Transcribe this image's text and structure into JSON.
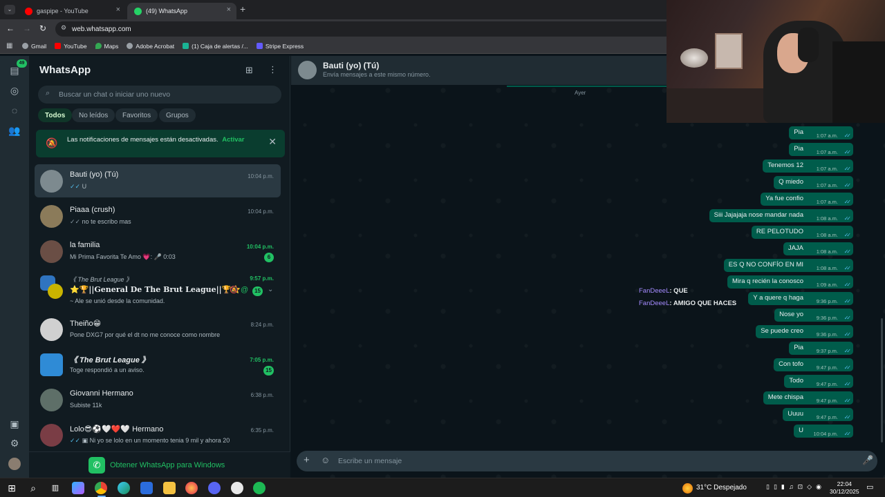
{
  "browser": {
    "tabs": [
      {
        "title": "gaspipe - YouTube"
      },
      {
        "title": "(49) WhatsApp"
      }
    ],
    "url": "web.whatsapp.com",
    "bookmarks": [
      "Gmail",
      "YouTube",
      "Maps",
      "Adobe Acrobat",
      "(1) Caja de alertas /...",
      "Stripe Express"
    ]
  },
  "rail": {
    "unread_badge": "49"
  },
  "sidebar": {
    "title": "WhatsApp",
    "search_placeholder": "Buscar un chat o iniciar uno nuevo",
    "filters": [
      "Todos",
      "No leídos",
      "Favoritos",
      "Grupos"
    ],
    "notification": {
      "text": "Las notificaciones de mensajes están desactivadas.",
      "action": "Activar"
    },
    "chats": [
      {
        "name": "Bauti (yo) (Tú)",
        "last": "U",
        "time": "10:04 p.m.",
        "checks": true
      },
      {
        "name": "Piaaa (crush)",
        "last": "no te escribo mas",
        "time": "10:04 p.m.",
        "checks": true
      },
      {
        "name": "la familia",
        "last": "Mi Prima Favorita Te Amo 💗: 🎤 0:03",
        "time": "10:04 p.m.",
        "badge": "6"
      },
      {
        "name": "⭐🏆||General De The Brut League||🏆⭐",
        "group": "《 The Brut League 》",
        "last": "~ Ale se unió desde la comunidad.",
        "time": "9:57 p.m.",
        "badge": "15"
      },
      {
        "name": "Theiño😁",
        "last": "Pone DXG7 por qué el dt no me conoce como nombre",
        "time": "8:24 p.m."
      },
      {
        "name": "《 The Brut League 》",
        "last": "Toge respondió a un aviso.",
        "time": "7:05 p.m.",
        "badge": "15"
      },
      {
        "name": "Giovanni Hermano",
        "last": "Subiste 11k",
        "time": "6:38 p.m."
      },
      {
        "name": "Lolo😎⚽🤍❤️🤍 Hermano",
        "last": "Ni yo se lolo en un momento tenia 9 mil y ahora 20",
        "time": "6:35 p.m.",
        "checks": true
      }
    ],
    "get_app": "Obtener WhatsApp para Windows"
  },
  "conversation": {
    "name": "Bauti (yo) (Tú)",
    "subtitle": "Envía mensajes a este mismo número.",
    "day": "Ayer",
    "messages": [
      {
        "text": "Pia",
        "time": "1:07 a.m."
      },
      {
        "text": "Pia",
        "time": "1:07 a.m."
      },
      {
        "text": "Tenemos 12",
        "time": "1:07 a.m."
      },
      {
        "text": "Q miedo",
        "time": "1:07 a.m."
      },
      {
        "text": "Ya fue confio",
        "time": "1:07 a.m."
      },
      {
        "text": "Siii Jajajaja nose mandar nada",
        "time": "1:08 a.m."
      },
      {
        "text": "RE PELOTUDO",
        "time": "1:08 a.m."
      },
      {
        "text": "JAJA",
        "time": "1:08 a.m."
      },
      {
        "text": "ES Q NO CONFÍO EN MI",
        "time": "1:08 a.m."
      },
      {
        "text": "Mira q recién la conosco",
        "time": "1:09 a.m."
      },
      {
        "text": "Y a quere q haga",
        "time": "9:36 p.m."
      },
      {
        "text": "Nose yo",
        "time": "9:36 p.m."
      },
      {
        "text": "Se puede creo",
        "time": "9:36 p.m."
      },
      {
        "text": "Pia",
        "time": "9:37 p.m."
      },
      {
        "text": "Con tofo",
        "time": "9:47 p.m."
      },
      {
        "text": "Todo",
        "time": "9:47 p.m."
      },
      {
        "text": "Mete chispa",
        "time": "9:47 p.m."
      },
      {
        "text": "Uuuu",
        "time": "9:47 p.m."
      },
      {
        "text": "U",
        "time": "10:04 p.m."
      }
    ],
    "stream_captions": [
      {
        "user": "FanDeeeL",
        "text": ": QUE"
      },
      {
        "user": "FanDeeeL",
        "text": ": AMIGO QUE HACES"
      }
    ],
    "composer_placeholder": "Escribe un mensaje"
  },
  "taskbar": {
    "weather": "31°C  Despejado",
    "time": "22:04",
    "date": "30/12/2025"
  }
}
